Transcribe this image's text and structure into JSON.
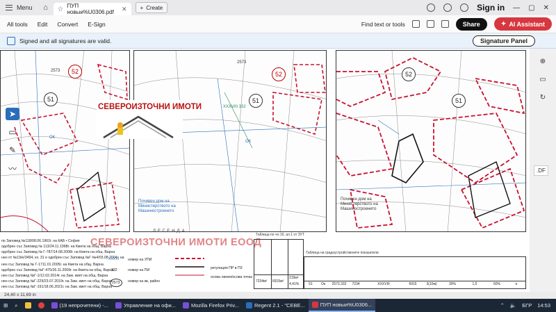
{
  "browser": {
    "menu_label": "Menu",
    "tab_title": "ПУП новыи%U0306.pdf",
    "create_label": "Create",
    "sign_in": "Sign in"
  },
  "toolbar": {
    "items": [
      "All tools",
      "Edit",
      "Convert",
      "E-Sign"
    ],
    "find": "Find text or tools",
    "share": "Share",
    "ai": "AI Assistant"
  },
  "sigbar": {
    "message": "Signed and all signatures are valid.",
    "panel": "Signature Panel"
  },
  "doc": {
    "logo_text": "СЕВЕРОИЗТОЧНИ ИМОТИ",
    "watermark": "СЕВЕРОИЗТОЧНИ ИМОТИ ЕООД",
    "legend_title": "ЛЕГЕНДА",
    "map_numbers": {
      "left_52": "52",
      "left_51": "51",
      "mid_52": "52",
      "mid_51": "51",
      "right_52": "52",
      "right_51": "51",
      "left_2573": "2573",
      "mid_2573": "2573"
    },
    "legend_rows": [
      "номер на УПИ",
      "номер на ПИ",
      "номер на кв, район"
    ],
    "legend_right": [
      "регулация ПР в П3",
      "ос­ова линия/осова точка"
    ],
    "legend_codes": [
      "XXXVI",
      "332",
      "2573"
    ],
    "table_caption": "Таблица по чл.16, ал.1 от ЗУТ",
    "table_caption2": "Таблица на градоустройствените показатели",
    "left_notes": [
      "по Заповед №118/08.06.1962г. на КАБ • София",
      "одобрен със Заповед № 113/24.11.1998г. на Кмета на общ. Варна",
      "одобрен със Заповед № Г-787/14.08.2008г. на Кмета на общ. Варна",
      "нен от №19/е/3494, кх. 31 е одобрен със Заповед №Г-№4/03.08.2004г. на",
      "нен със Заповед № Г-1711.01.2005г. на Кмета на общ. Варна",
      "одобрен със Заповед №Г-475/26.11.2009г. на Кмета на общ. Варна",
      "нен със Заповед №Г-1/12.02.2014г. на Зам. кмет на общ. Варна",
      "нен със Заповед №Г-229/23.07.2019г. на Зам. кмет на общ. Варна",
      "нен със Заповед №Г-191/18.06.2021г. на Зам. кмет на общ. Варна"
    ],
    "map_text": {
      "house_label": "Почивен дом на Министерството на Машиностроенето",
      "area_label": "XXXVIII 332",
      "ok": "ОК"
    },
    "table_values": {
      "area": "7234м²",
      "area2": "6915м²",
      "pct": "219м²",
      "pct2": "4,41%",
      "row": [
        "51",
        "Ок",
        "2573.332",
        "7234",
        "XXXVIII",
        "6915",
        "3(10м)",
        "30%",
        "1,5",
        "60%",
        "е"
      ]
    }
  },
  "status": {
    "dimensions": "24,40 x 11,69 in"
  },
  "taskbar": {
    "items": [
      "(19 непрочетени) -...",
      "Управление на офи...",
      "Mozilla Firefox Priv...",
      "Regent 2.1 - \"СЕВЕ...",
      "ПУП новыи%U0306..."
    ],
    "lang": "БГР",
    "time": "14:53"
  },
  "colors": {
    "accent": "#2a6ebb",
    "ai_red": "#d7373f",
    "plan_red": "#c8102e"
  }
}
